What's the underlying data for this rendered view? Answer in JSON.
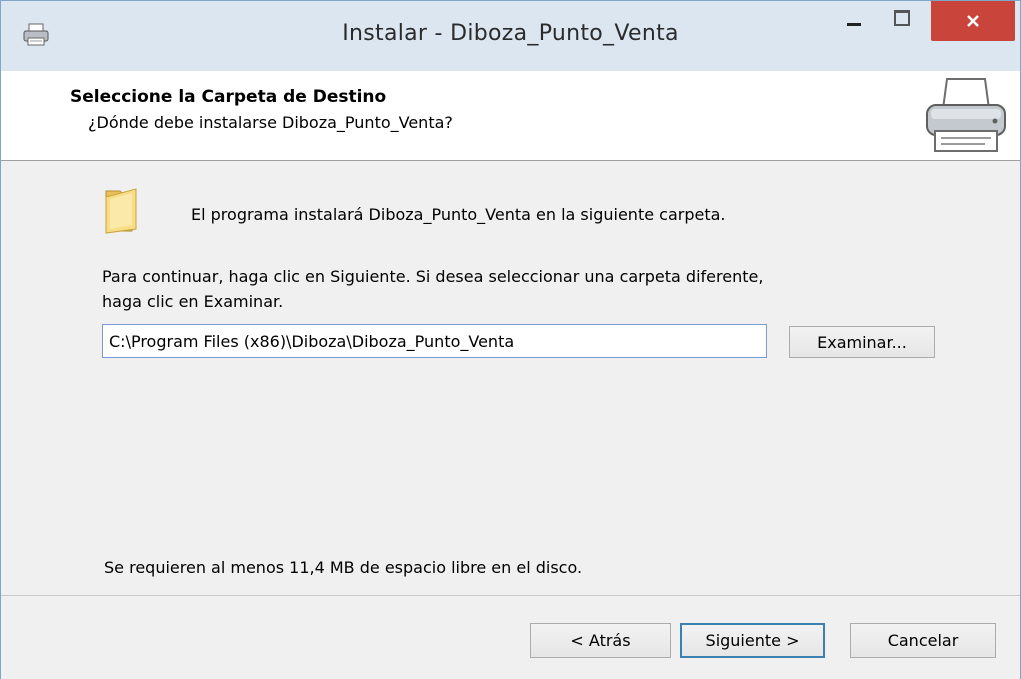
{
  "window": {
    "title": "Instalar - Diboza_Punto_Venta"
  },
  "header": {
    "title": "Seleccione la Carpeta de Destino",
    "subtitle": "¿Dónde debe instalarse Diboza_Punto_Venta?"
  },
  "body": {
    "intro": "El programa instalará Diboza_Punto_Venta en la siguiente carpeta.",
    "continue_line1": "Para continuar, haga clic en Siguiente. Si desea seleccionar una carpeta diferente,",
    "continue_line2": "haga clic en Examinar.",
    "install_path": "C:\\Program Files (x86)\\Diboza\\Diboza_Punto_Venta",
    "browse_label": "Examinar...",
    "space_required": "Se requieren al menos 11,4 MB de espacio libre en el disco."
  },
  "footer": {
    "back_label": "< Atrás",
    "next_label": "Siguiente >",
    "cancel_label": "Cancelar"
  },
  "icons": {
    "app": "installer-printer-icon",
    "header": "printer-icon",
    "folder": "folder-icon",
    "minimize": "minimize-icon",
    "maximize": "maximize-icon",
    "close": "close-icon"
  },
  "colors": {
    "titlebar": "#dbe6f1",
    "close_button": "#c9453b",
    "default_button_border": "#3c7fb1",
    "dialog_background": "#f0f0f0"
  }
}
